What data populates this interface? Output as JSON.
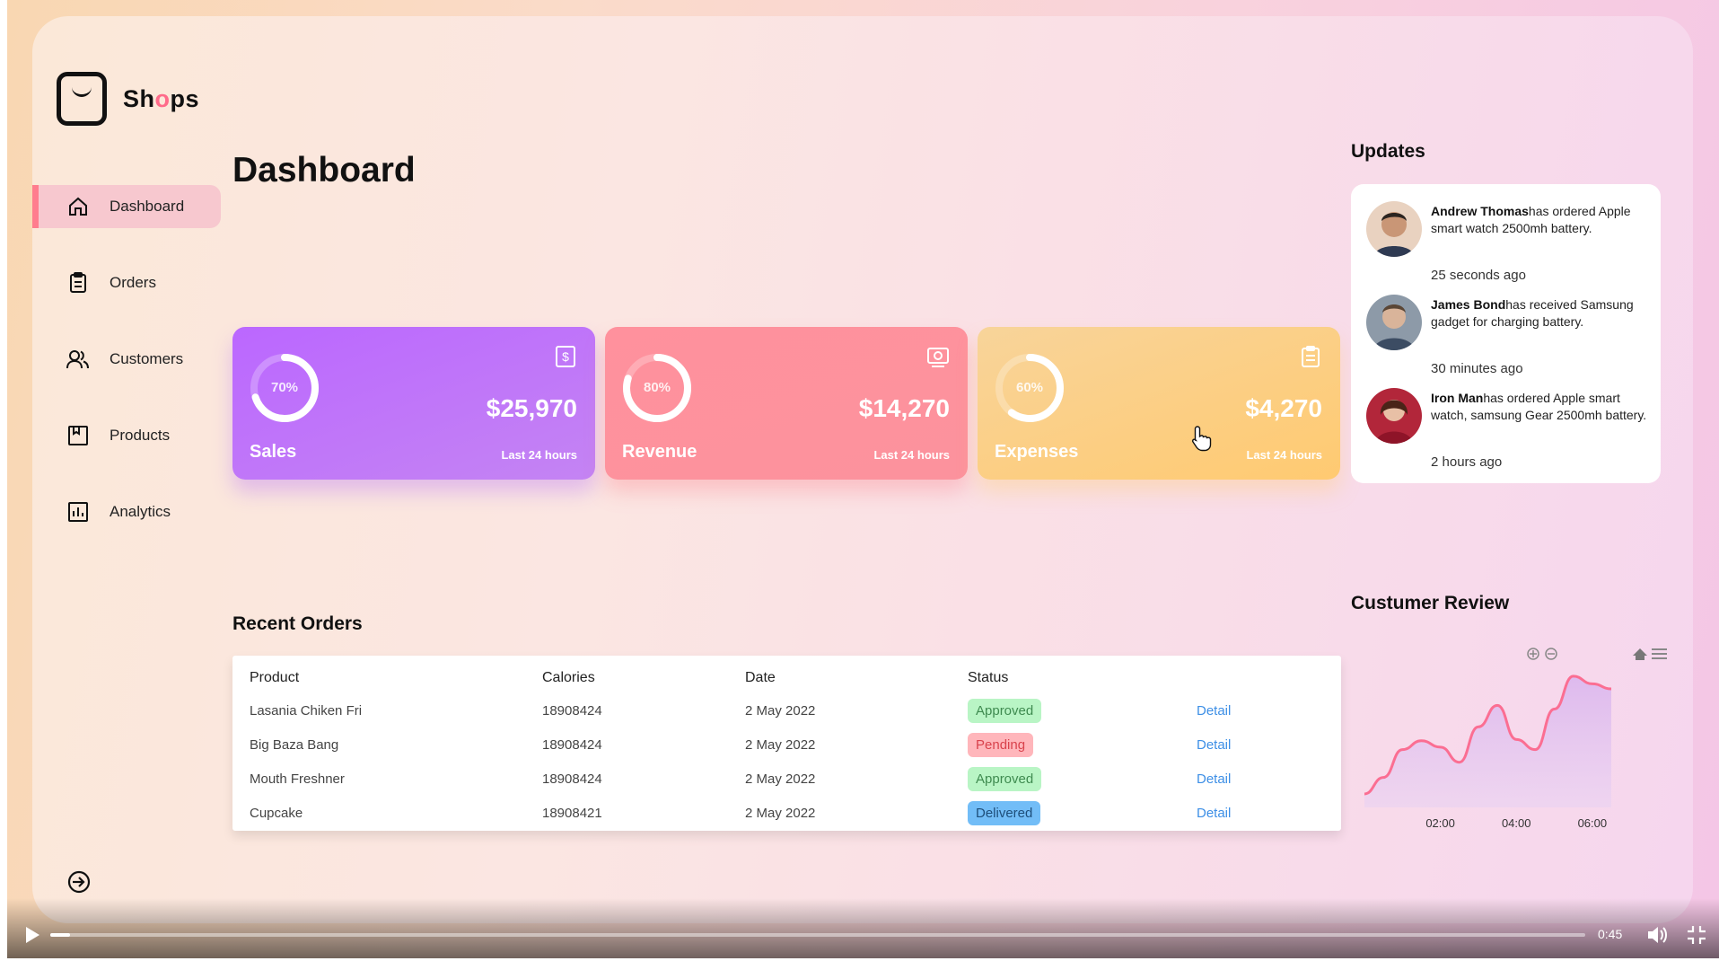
{
  "brand": {
    "name_prefix": "Sh",
    "name_o": "o",
    "name_suffix": "ps"
  },
  "sidebar": {
    "items": [
      {
        "label": "Dashboard",
        "icon": "home-icon",
        "active": true
      },
      {
        "label": "Orders",
        "icon": "clipboard-icon",
        "active": false
      },
      {
        "label": "Customers",
        "icon": "users-icon",
        "active": false
      },
      {
        "label": "Products",
        "icon": "product-box-icon",
        "active": false
      },
      {
        "label": "Analytics",
        "icon": "bar-chart-icon",
        "active": false
      }
    ],
    "signout_icon": "sign-out-icon"
  },
  "page_title": "Dashboard",
  "cards": [
    {
      "label": "Sales",
      "value": "$25,970",
      "percent": "70%",
      "fill": 0.7,
      "sub": "Last 24 hours",
      "icon": "dollar-icon",
      "color": "#bb67ff"
    },
    {
      "label": "Revenue",
      "value": "$14,270",
      "percent": "80%",
      "fill": 0.8,
      "sub": "Last 24 hours",
      "icon": "money-icon",
      "color": "#ff919d"
    },
    {
      "label": "Expenses",
      "value": "$4,270",
      "percent": "60%",
      "fill": 0.6,
      "sub": "Last 24 hours",
      "icon": "clipboard-icon",
      "color": "#ffca71"
    }
  ],
  "recent_orders": {
    "title": "Recent Orders",
    "headers": [
      "Product",
      "Calories",
      "Date",
      "Status"
    ],
    "rows": [
      {
        "product": "Lasania Chiken Fri",
        "calories": "18908424",
        "date": "2 May 2022",
        "status": "Approved",
        "status_kind": "green",
        "action": "Detail"
      },
      {
        "product": "Big Baza Bang",
        "calories": "18908424",
        "date": "2 May 2022",
        "status": "Pending",
        "status_kind": "red",
        "action": "Detail"
      },
      {
        "product": "Mouth Freshner",
        "calories": "18908424",
        "date": "2 May 2022",
        "status": "Approved",
        "status_kind": "green",
        "action": "Detail"
      },
      {
        "product": "Cupcake",
        "calories": "18908421",
        "date": "2 May 2022",
        "status": "Delivered",
        "status_kind": "blue",
        "action": "Detail"
      }
    ]
  },
  "updates": {
    "title": "Updates",
    "items": [
      {
        "name": "Andrew Thomas",
        "text": "has ordered Apple smart watch 2500mh battery.",
        "time": "25 seconds ago"
      },
      {
        "name": "James Bond",
        "text": "has received Samsung gadget for charging battery.",
        "time": "30 minutes ago"
      },
      {
        "name": "Iron Man",
        "text": "has ordered Apple smart watch, samsung Gear 2500mh battery.",
        "time": "2 hours ago"
      }
    ]
  },
  "review": {
    "title": "Custumer Review",
    "toolbar_icons": [
      "zoom-in-icon",
      "zoom-out-icon",
      "home-icon",
      "menu-icon"
    ]
  },
  "chart_data": {
    "type": "area",
    "title": "Custumer Review",
    "x": [
      "00:00",
      "00:30",
      "01:00",
      "01:30",
      "02:00",
      "02:30",
      "03:00",
      "03:30",
      "04:00",
      "04:30",
      "05:00",
      "05:30",
      "06:00",
      "06:30"
    ],
    "tick_labels": [
      "02:00",
      "04:00",
      "06:00"
    ],
    "series": [
      {
        "values": [
          5,
          18,
          40,
          47,
          42,
          30,
          58,
          75,
          48,
          40,
          72,
          98,
          92,
          88
        ]
      }
    ],
    "ylim": [
      0,
      110
    ],
    "grid": false
  },
  "video": {
    "time": "0:45",
    "progress": 0.013
  }
}
